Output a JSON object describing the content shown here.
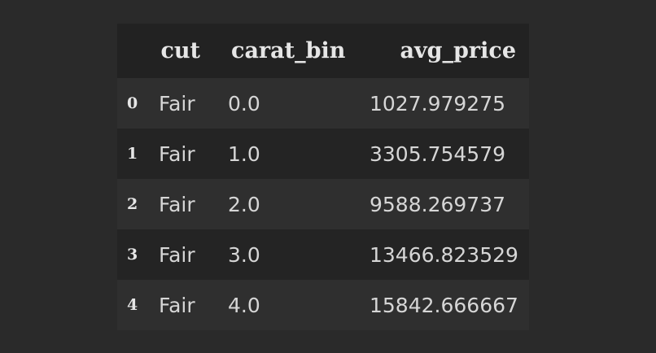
{
  "dataframe": {
    "columns": {
      "index": "",
      "cut": "cut",
      "carat_bin": "carat_bin",
      "avg_price": "avg_price"
    },
    "rows": [
      {
        "index": "0",
        "cut": "Fair",
        "carat_bin": "0.0",
        "avg_price": "1027.979275"
      },
      {
        "index": "1",
        "cut": "Fair",
        "carat_bin": "1.0",
        "avg_price": "3305.754579"
      },
      {
        "index": "2",
        "cut": "Fair",
        "carat_bin": "2.0",
        "avg_price": "9588.269737"
      },
      {
        "index": "3",
        "cut": "Fair",
        "carat_bin": "3.0",
        "avg_price": "13466.823529"
      },
      {
        "index": "4",
        "cut": "Fair",
        "carat_bin": "4.0",
        "avg_price": "15842.666667"
      }
    ]
  }
}
